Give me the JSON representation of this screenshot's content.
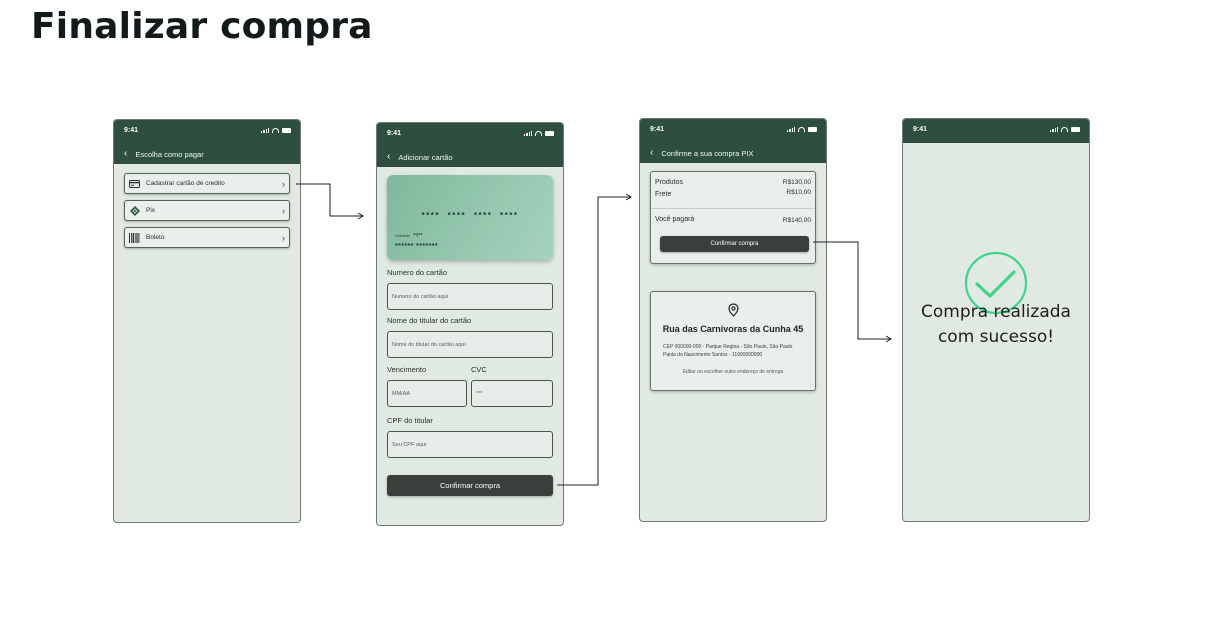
{
  "page_title": "Finalizar compra",
  "status_time": "9:41",
  "screen1": {
    "nav_title": "Escolha como pagar",
    "options": [
      {
        "label": "Cadastrar cartão de credito",
        "icon": "card-icon"
      },
      {
        "label": "Pix",
        "icon": "pix-icon"
      },
      {
        "label": "Boleto",
        "icon": "barcode-icon"
      }
    ]
  },
  "screen2": {
    "nav_title": "Adicionar  cartão",
    "card": {
      "number": "**** **** **** ****",
      "validity_label": "Validade",
      "validity": "**/**",
      "holder": "****** *******"
    },
    "fields": {
      "card_number": {
        "label": "Numero do cartão",
        "placeholder": "Numero do cartão aqui"
      },
      "holder_name": {
        "label": "Nome do titular do cartão",
        "placeholder": "Nome do titular do cartão  aqui"
      },
      "expiry": {
        "label": "Vencimento",
        "placeholder": "MM/AA"
      },
      "cvc": {
        "label": "CVC",
        "placeholder": "***"
      },
      "cpf": {
        "label": "CPF do titular",
        "placeholder": "Seu CPF aqui"
      }
    },
    "confirm_label": "Confirmar compra"
  },
  "screen3": {
    "nav_title": "Confirme a sua compra PIX",
    "summary": {
      "products_label": "Produtos",
      "products_value": "R$130,00",
      "shipping_label": "Frete",
      "shipping_value": "R$10,00",
      "total_label": "Você pagará",
      "total_value": "R$140,00"
    },
    "confirm_label": "Confirmar compra",
    "address": {
      "title": "Rua das Carnívoras da Cunha 45",
      "line1": "CEP 000000-000 - Parque Regina - São Paulo, São Paulo",
      "line2": "Paola do Nascimento Santos - 11900000000",
      "edit": "Editar ou escolher outro endereço de entrega"
    }
  },
  "screen4": {
    "success_line1": "Compra realizada",
    "success_line2": "com sucesso!"
  },
  "colors": {
    "header_green": "#2e4f40",
    "screen_bg": "#e1e9e3",
    "success_green": "#3ed48a",
    "button_dark": "#3a3f3c"
  }
}
